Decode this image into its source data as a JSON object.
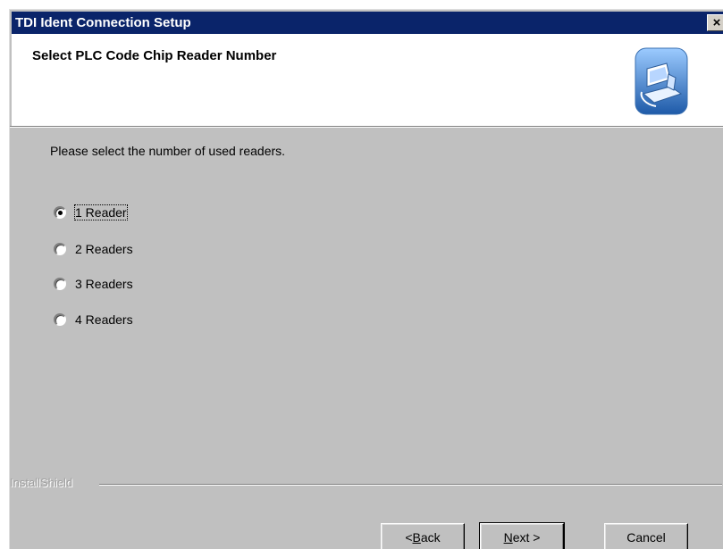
{
  "window": {
    "title": "TDI Ident Connection Setup",
    "close_glyph": "×"
  },
  "header": {
    "title": "Select PLC Code Chip Reader Number",
    "logo_icon": "installer-computer-icon"
  },
  "instruction": "Please select the number of used readers.",
  "options": [
    {
      "label": "1 Reader",
      "selected": true
    },
    {
      "label": "2 Readers",
      "selected": false
    },
    {
      "label": "3 Readers",
      "selected": false
    },
    {
      "label": "4 Readers",
      "selected": false
    }
  ],
  "brand": "InstallShield",
  "buttons": {
    "back": {
      "accel": "B",
      "rest": "ack",
      "prefix": "< "
    },
    "next": {
      "accel": "N",
      "rest": "ext >"
    },
    "cancel": "Cancel"
  },
  "colors": {
    "titlebar": "#0a246a",
    "face": "#c0c0c0"
  }
}
